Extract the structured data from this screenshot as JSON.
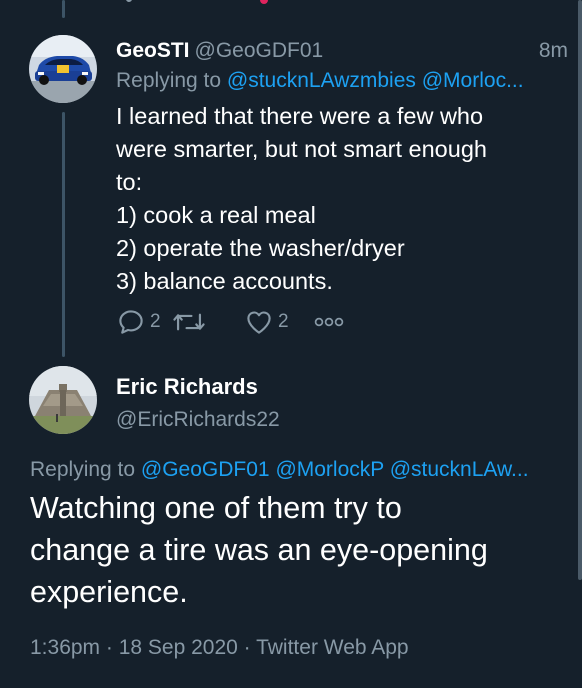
{
  "tweet1": {
    "name": "GeoSTI",
    "handle": "@GeoGDF01",
    "time": "8m",
    "replying_prefix": "Replying to ",
    "replying_mentions": "@stucknLAwzmbies @Morloc...",
    "lines": [
      "I learned that there were a few who",
      "were smarter, but not smart enough",
      "to:",
      "1) cook a real meal",
      "2) operate the washer/dryer",
      "3) balance accounts."
    ],
    "reply_count": "2",
    "retweet_count": "",
    "like_count": "2",
    "avatar_icon": "rally-car-avatar"
  },
  "tweet2": {
    "name": "Eric Richards",
    "handle": "@EricRichards22",
    "replying_prefix": "Replying to ",
    "replying_mentions": "@GeoGDF01 @MorlockP @stucknLAw...",
    "lines": [
      "Watching one of them try to",
      "change a tire was an eye-opening",
      "experience."
    ],
    "timestamp": "1:36pm · 18 Sep 2020 · Twitter Web App",
    "avatar_icon": "pyramid-avatar"
  },
  "colors": {
    "background": "#15202b",
    "secondary_text": "#8899a6",
    "link": "#1da1f2",
    "thread_line": "#3d5466"
  }
}
